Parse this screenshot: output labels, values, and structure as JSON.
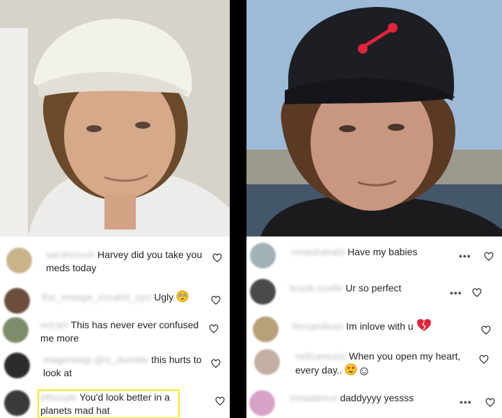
{
  "left": {
    "comments": [
      {
        "username": "sarahrouch",
        "text": "Harvey did you take you meds today",
        "avatar_color": "#c9b48a"
      },
      {
        "username": "the_vintage_vocalist_uyo",
        "text": "Ugly",
        "avatar_color": "#6b4f3c"
      },
      {
        "username": "ericarr",
        "text": "This has never ever confused me more",
        "avatar_color": "#7f8c6a"
      },
      {
        "username": "magentasp @iz_dumble",
        "text": "this hurts to look at",
        "avatar_color": "#2b2b2b"
      },
      {
        "username": "ethosyle",
        "text": "You'd look better in a planets mad hat",
        "avatar_color": "#3a3a3a"
      }
    ]
  },
  "right": {
    "comments": [
      {
        "username": "ronashahabi",
        "text": "Have my babies",
        "avatar_color": "#9fb2b5",
        "has_dots": true
      },
      {
        "username": "brook.noelle",
        "text": "Ur so perfect",
        "avatar_color": "#4a4a4a",
        "has_dots": true
      },
      {
        "username": "fernandisan",
        "text": "Im inlove with u",
        "avatar_color": "#b8a07a",
        "has_dots": false
      },
      {
        "username": "nellcamusic",
        "text": "When you open my heart, every day..",
        "avatar_color": "#c4b0a2",
        "has_dots": false
      },
      {
        "username": "imraalence",
        "text": "daddyyyy yessss",
        "avatar_color": "#d8a2c8",
        "has_dots": true
      }
    ]
  },
  "icons": {
    "heart": "heart-outline-icon",
    "more": "more-options-icon"
  },
  "colors": {
    "highlight": "#f5ef1a",
    "emoji_red": "#e0243a",
    "emoji_yellow": "#f7c52b"
  },
  "more_glyph": "•••"
}
